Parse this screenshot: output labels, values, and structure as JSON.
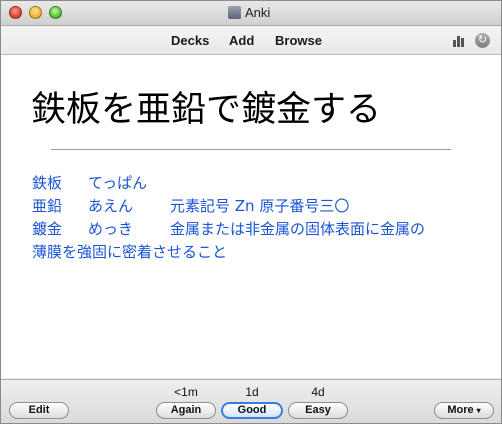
{
  "window": {
    "title": "Anki"
  },
  "toolbar": {
    "decks": "Decks",
    "add": "Add",
    "browse": "Browse"
  },
  "card": {
    "question": "鉄板を亜鉛で鍍金する",
    "answer_lines": [
      [
        "鉄板",
        "てっぱん",
        ""
      ],
      [
        "亜鉛",
        "あえん",
        "元素記号 Zn 原子番号三〇"
      ],
      [
        "鍍金",
        "めっき",
        "金属または非金属の固体表面に金属の"
      ],
      [
        "薄膜を強固に密着させること",
        "",
        ""
      ]
    ]
  },
  "bottom": {
    "edit": "Edit",
    "buttons": [
      {
        "due": "<1m",
        "label": "Again"
      },
      {
        "due": "1d",
        "label": "Good"
      },
      {
        "due": "4d",
        "label": "Easy"
      }
    ],
    "more": "More",
    "more_arrow": "▾"
  },
  "colors": {
    "answer_text": "#1a55d4",
    "default_button_border": "#3a7be0"
  },
  "icons": {
    "stats": "bar-chart-icon",
    "sync": "sync-icon"
  }
}
